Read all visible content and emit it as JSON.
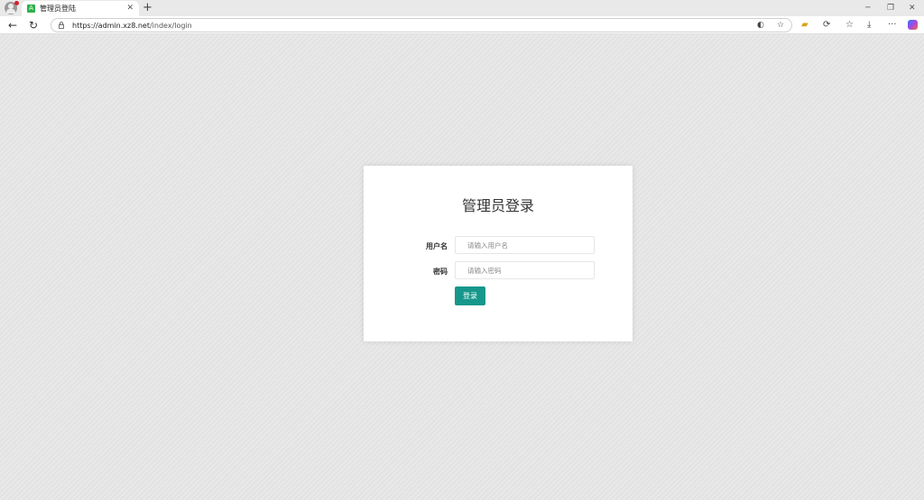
{
  "browser": {
    "tab_title": "管理员登陆",
    "tab_favicon_letter": "A",
    "url_host": "https://admin.xz8.net",
    "url_path": "/index/login",
    "icons": {
      "profile": "profile-avatar-icon",
      "back": "back-arrow-icon",
      "refresh": "refresh-icon",
      "lock": "lock-icon",
      "read_aloud": "read-aloud-icon",
      "favorite": "star-icon",
      "collections": "folder-icon",
      "extensions": "extensions-icon",
      "favorites_list": "favorites-icon",
      "downloads": "download-icon",
      "more": "more-icon",
      "copilot": "copilot-icon"
    }
  },
  "login": {
    "heading": "管理员登录",
    "username_label": "用户名",
    "username_placeholder": "请输入用户名",
    "password_label": "密码",
    "password_placeholder": "请输入密码",
    "submit_label": "登录"
  },
  "colors": {
    "accent": "#16978b",
    "favicon": "#2db14a"
  }
}
